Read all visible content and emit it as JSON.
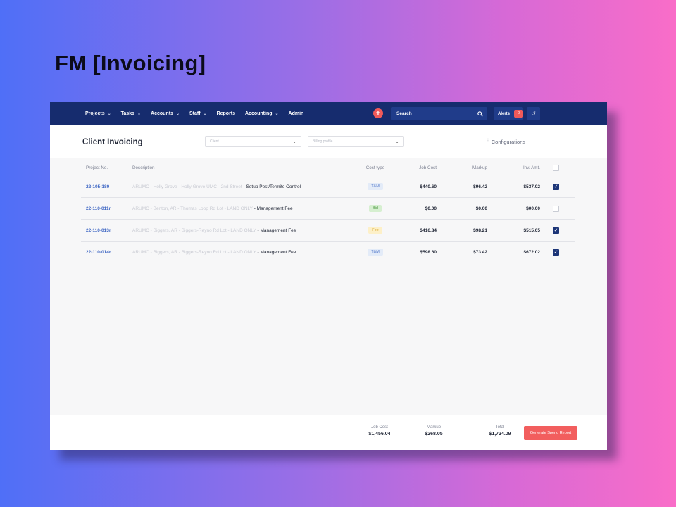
{
  "page": {
    "title": "FM [Invoicing]"
  },
  "nav": {
    "items": [
      {
        "label": "Projects",
        "dropdown": true
      },
      {
        "label": "Tasks",
        "dropdown": true
      },
      {
        "label": "Accounts",
        "dropdown": true
      },
      {
        "label": "Staff",
        "dropdown": true
      },
      {
        "label": "Reports",
        "dropdown": false
      },
      {
        "label": "Accounting",
        "dropdown": true
      },
      {
        "label": "Admin",
        "dropdown": false
      }
    ],
    "add_icon": "plus-icon",
    "search_label": "Search",
    "alerts_label": "Alerts",
    "alerts_count": "0"
  },
  "header": {
    "title": "Client Invoicing",
    "client_placeholder": "Client",
    "billing_placeholder": "Billing profile",
    "configurations_label": "Configurations"
  },
  "table": {
    "columns": [
      "Project No.",
      "Description",
      "Cost type",
      "Job Cost",
      "Markup",
      "Inv. Amt."
    ],
    "rows": [
      {
        "project": "22-105-180",
        "desc_muted": "ARUMC - Holly Grove - Holly Grove UMC - 2nd Street",
        "desc_main": " - Setup Pest/Termite Control",
        "cost_type": "T&M",
        "job_cost": "$440.60",
        "markup": "$96.42",
        "inv_amt": "$537.02",
        "checked": true
      },
      {
        "project": "22-110-011r",
        "desc_muted": "ARUMC - Benton, AR - Thomas Loop Rd Lot - LAND ONLY",
        "desc_main": " - Management Fee",
        "cost_type": "Bid",
        "job_cost": "$0.00",
        "markup": "$0.00",
        "inv_amt": "$00.00",
        "checked": false
      },
      {
        "project": "22-110-013r",
        "desc_muted": "ARUMC - Biggers, AR - Biggers-Reyno Rd Lot - LAND ONLY",
        "desc_main": " - Management Fee",
        "cost_type": "Fee",
        "job_cost": "$416.84",
        "markup": "$98.21",
        "inv_amt": "$515.05",
        "checked": true
      },
      {
        "project": "22-110-014r",
        "desc_muted": "ARUMC - Biggers, AR - Biggers-Reyno Rd Lot - LAND ONLY",
        "desc_main": " - Management Fee",
        "cost_type": "T&M",
        "job_cost": "$598.60",
        "markup": "$73.42",
        "inv_amt": "$672.02",
        "checked": true
      }
    ]
  },
  "footer": {
    "job_cost_label": "Job Cost",
    "job_cost_value": "$1,456.04",
    "markup_label": "Markup",
    "markup_value": "$268.05",
    "total_label": "Total",
    "total_value": "$1,724.09",
    "generate_label": "Generate Spend Report"
  },
  "colors": {
    "nav_bg": "#162c6e",
    "accent_red": "#f25e5e",
    "link_blue": "#3f67c4"
  }
}
